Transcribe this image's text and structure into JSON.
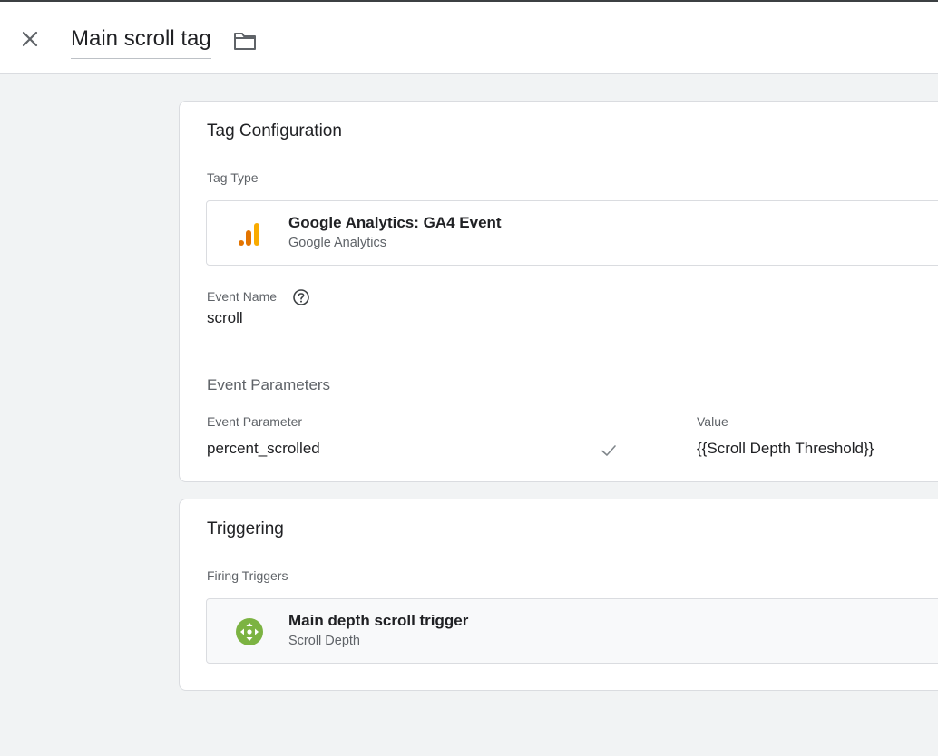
{
  "header": {
    "title": "Main scroll tag",
    "close_icon": "close-icon",
    "folder_icon": "folder-icon"
  },
  "tag_configuration": {
    "title": "Tag Configuration",
    "tag_type_label": "Tag Type",
    "tag_type": {
      "name": "Google Analytics: GA4 Event",
      "provider": "Google Analytics",
      "icon": "google-analytics-icon",
      "icon_colors": [
        "#E37400",
        "#F9AB00"
      ]
    },
    "event_name_label": "Event Name",
    "event_name_value": "scroll",
    "event_parameters_label": "Event Parameters",
    "parameter_column": "Event Parameter",
    "value_column": "Value",
    "parameters": [
      {
        "name": "percent_scrolled",
        "value": "{{Scroll Depth Threshold}}"
      }
    ]
  },
  "triggering": {
    "title": "Triggering",
    "firing_triggers_label": "Firing Triggers",
    "triggers": [
      {
        "name": "Main depth scroll trigger",
        "type": "Scroll Depth",
        "icon": "scroll-depth-icon",
        "icon_color": "#7CB342"
      }
    ]
  }
}
